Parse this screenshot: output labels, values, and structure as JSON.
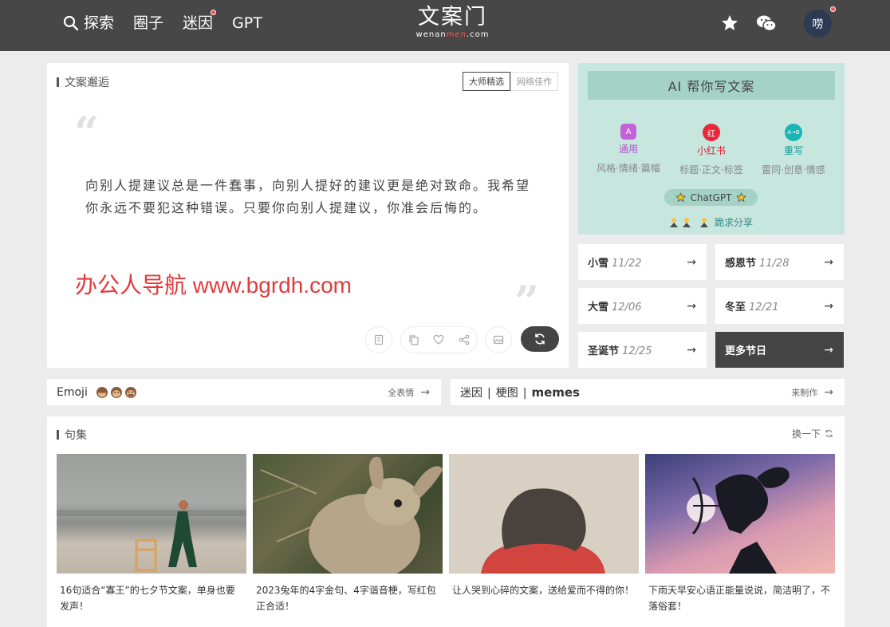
{
  "header": {
    "nav": [
      "探索",
      "圈子",
      "迷因",
      "GPT"
    ],
    "logo_main": "文案门",
    "logo_sub_a": "wenan",
    "logo_sub_b": "men",
    "logo_sub_c": ".com",
    "avatar_text": "唠",
    "icons": [
      "search-icon",
      "star-icon",
      "wechat-icon"
    ]
  },
  "quote_panel": {
    "title": "文案邂逅",
    "tabs": [
      "大师精选",
      "网络佳作"
    ],
    "open_quote": "“",
    "close_quote": "”",
    "text": "向别人提建议总是一件蠢事，向别人提好的建议更是绝对致命。我希望你永远不要犯这种错误。只要你向别人提建议，你准会后悔的。",
    "watermark": "办公人导航  www.bgrdh.com"
  },
  "ai_panel": {
    "button": "AI 帮你写文案",
    "cols": [
      {
        "name": "通用",
        "desc": "风格·情绪·篇幅",
        "icon_text": "A",
        "color": "#c561d9"
      },
      {
        "name": "小红书",
        "desc": "标题·正文·标签",
        "icon_text": "红",
        "color": "#e8283a"
      },
      {
        "name": "重写",
        "desc": "雷同·创意·情感",
        "icon_text": "A→B",
        "color": "#19b4b4"
      }
    ],
    "gpt_pill": "ChatGPT",
    "share": "跪求分享"
  },
  "festivals": [
    {
      "name": "小雪",
      "date": "11/22"
    },
    {
      "name": "感恩节",
      "date": "11/28"
    },
    {
      "name": "大雪",
      "date": "12/06"
    },
    {
      "name": "冬至",
      "date": "12/21"
    },
    {
      "name": "圣诞节",
      "date": "12/25"
    },
    {
      "name": "更多节日",
      "date": ""
    }
  ],
  "arrow": "→",
  "emoji_bar": {
    "title": "Emoji",
    "emojis": "🙈🙉🙊",
    "link": "全表情"
  },
  "meme_bar": {
    "title_a": "迷因",
    "title_b": "梗图",
    "title_c": "memes",
    "link": "来制作"
  },
  "juji": {
    "title": "句集",
    "refresh": "换一下",
    "cards": [
      "16句适合“寡王”的七夕节文案，单身也要发声！",
      "2023兔年的4字金句、4字谐音梗，写红包正合适！",
      "让人哭到心碎的文案，送给爱而不得的你！",
      "下雨天早安心语正能量说说，简洁明了，不落俗套！"
    ]
  }
}
